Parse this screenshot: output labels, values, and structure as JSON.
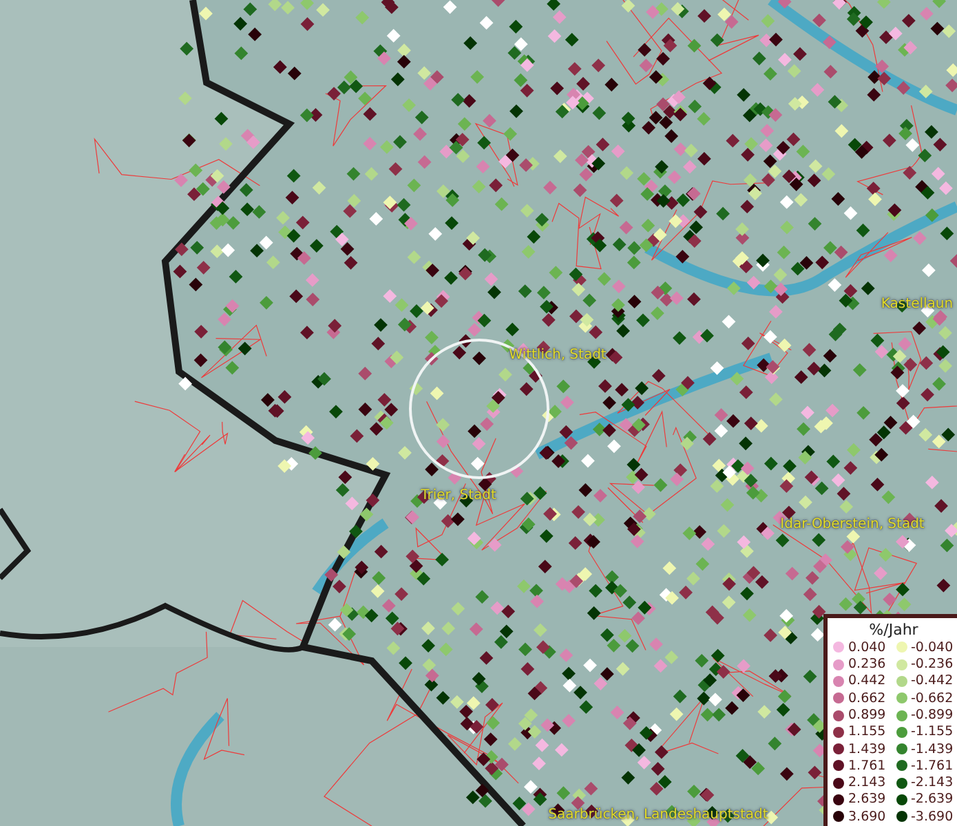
{
  "places": [
    {
      "label": "Kastellaun"
    },
    {
      "label": "Wittlich, Stadt"
    },
    {
      "label": "Trier, Stadt"
    },
    {
      "label": "Idar-Oberstein, Stadt"
    },
    {
      "label": "Saarbrücken, Landeshauptstadt"
    }
  ],
  "legend": {
    "title": "%/Jahr",
    "rows": [
      {
        "positive": {
          "value": "0.040",
          "color": "#f4b8e0"
        },
        "negative": {
          "value": "-0.040",
          "color": "#eef6b0"
        }
      },
      {
        "positive": {
          "value": "0.236",
          "color": "#e69cc8"
        },
        "negative": {
          "value": "-0.236",
          "color": "#d0e8a0"
        }
      },
      {
        "positive": {
          "value": "0.442",
          "color": "#d884b0"
        },
        "negative": {
          "value": "-0.442",
          "color": "#b2d88a"
        }
      },
      {
        "positive": {
          "value": "0.662",
          "color": "#c66a92"
        },
        "negative": {
          "value": "-0.662",
          "color": "#8ec86c"
        }
      },
      {
        "positive": {
          "value": "0.899",
          "color": "#aa4c6c"
        },
        "negative": {
          "value": "-0.899",
          "color": "#6cb452"
        }
      },
      {
        "positive": {
          "value": "1.155",
          "color": "#8e3048"
        },
        "negative": {
          "value": "-1.155",
          "color": "#4c9c3c"
        }
      },
      {
        "positive": {
          "value": "1.439",
          "color": "#7a2038"
        },
        "negative": {
          "value": "-1.439",
          "color": "#34842e"
        }
      },
      {
        "positive": {
          "value": "1.761",
          "color": "#601226"
        },
        "negative": {
          "value": "-1.761",
          "color": "#1f6a20"
        }
      },
      {
        "positive": {
          "value": "2.143",
          "color": "#4a0818"
        },
        "negative": {
          "value": "-2.143",
          "color": "#105812"
        }
      },
      {
        "positive": {
          "value": "2.639",
          "color": "#3a0410"
        },
        "negative": {
          "value": "-2.639",
          "color": "#084808"
        }
      },
      {
        "positive": {
          "value": "3.690",
          "color": "#280208"
        },
        "negative": {
          "value": "-3.690",
          "color": "#043404"
        }
      }
    ]
  }
}
